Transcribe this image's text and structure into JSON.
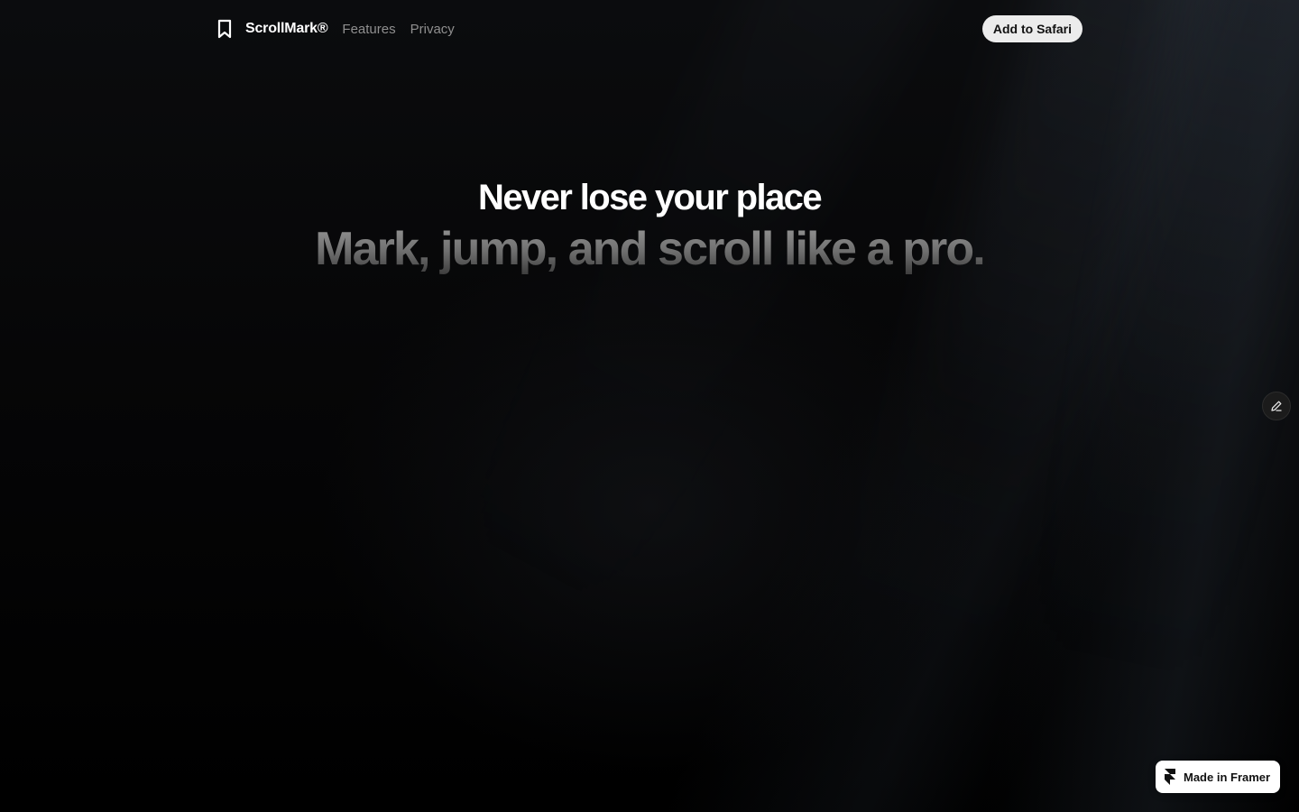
{
  "nav": {
    "brand_icon": "bookmark-icon",
    "brand_name": "ScrollMark®",
    "links": [
      {
        "label": "Features"
      },
      {
        "label": "Privacy"
      }
    ],
    "cta_label": "Add to Safari"
  },
  "hero": {
    "title": "Never lose your place",
    "subtitle": "Mark, jump, and scroll like a pro."
  },
  "floating": {
    "edit_icon": "pencil-icon"
  },
  "badge": {
    "icon": "framer-logo-icon",
    "label": "Made in Framer"
  },
  "colors": {
    "background": "#000000",
    "cta_background": "#ececec",
    "nav_link": "#8f8f8f",
    "subtitle_gray": "#8a8a8a"
  }
}
